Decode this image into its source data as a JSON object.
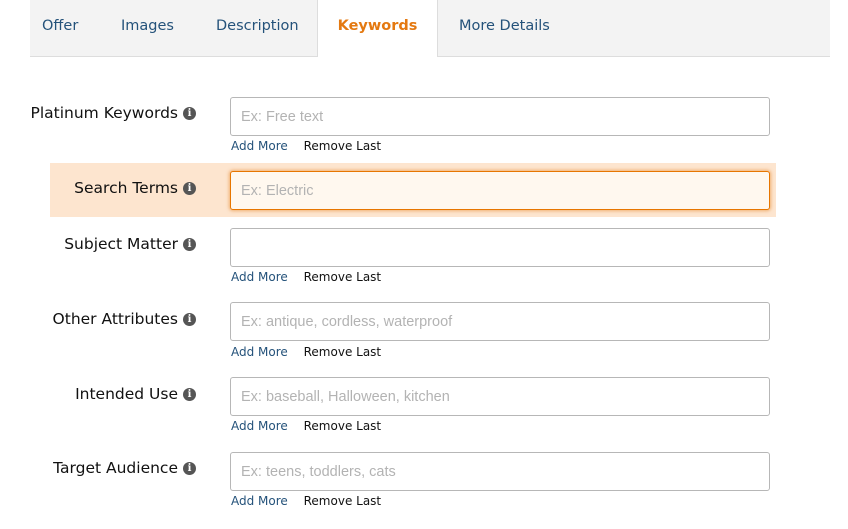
{
  "tabs": [
    {
      "label": "Offer"
    },
    {
      "label": "Images"
    },
    {
      "label": "Description"
    },
    {
      "label": "Keywords",
      "active": true
    },
    {
      "label": "More Details"
    }
  ],
  "fields": {
    "platinum_keywords": {
      "label": "Platinum Keywords",
      "placeholder": "Ex: Free text",
      "value": ""
    },
    "search_terms": {
      "label": "Search Terms",
      "placeholder": "Ex: Electric",
      "value": ""
    },
    "subject_matter": {
      "label": "Subject Matter",
      "placeholder": "",
      "value": ""
    },
    "other_attributes": {
      "label": "Other Attributes",
      "placeholder": "Ex: antique, cordless, waterproof",
      "value": ""
    },
    "intended_use": {
      "label": "Intended Use",
      "placeholder": "Ex: baseball, Halloween, kitchen",
      "value": ""
    },
    "target_audience": {
      "label": "Target Audience",
      "placeholder": "Ex: teens, toddlers, cats",
      "value": ""
    }
  },
  "actions": {
    "add_more": "Add More",
    "remove_last": "Remove Last"
  },
  "info_glyph": "i",
  "colors": {
    "accent": "#e47911",
    "link": "#24527a",
    "highlight": "#fde5cf"
  }
}
